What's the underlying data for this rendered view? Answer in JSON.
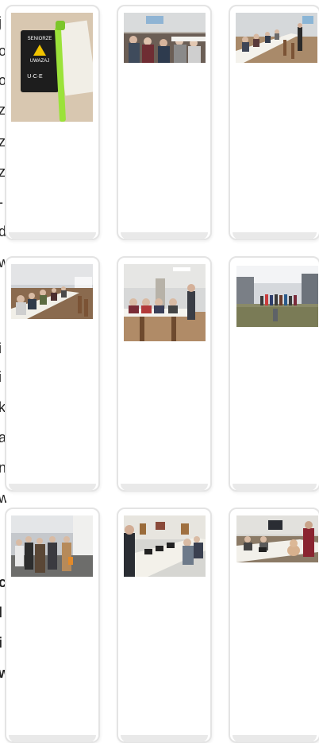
{
  "gallery": {
    "edge_letters": [
      "j",
      "o",
      "o",
      "z",
      "z",
      "z",
      "-",
      "d",
      "w",
      "",
      "",
      "i",
      "i",
      "k",
      "a",
      "n",
      "w",
      "",
      "",
      "c",
      "l",
      "i",
      "w"
    ],
    "items": [
      {
        "photo": "brochure-photo",
        "caption": ""
      },
      {
        "photo": "seniors-meeting-hall-photo",
        "caption": ""
      },
      {
        "photo": "long-table-meeting-photo",
        "caption": ""
      },
      {
        "photo": "seniors-at-table-photo",
        "caption": ""
      },
      {
        "photo": "presenter-at-table-photo",
        "caption": ""
      },
      {
        "photo": "group-outdoor-photo",
        "caption": ""
      },
      {
        "photo": "group-street-photo",
        "caption": ""
      },
      {
        "photo": "computer-workshop-photo",
        "caption": ""
      },
      {
        "photo": "first-aid-training-photo",
        "caption": ""
      }
    ]
  }
}
